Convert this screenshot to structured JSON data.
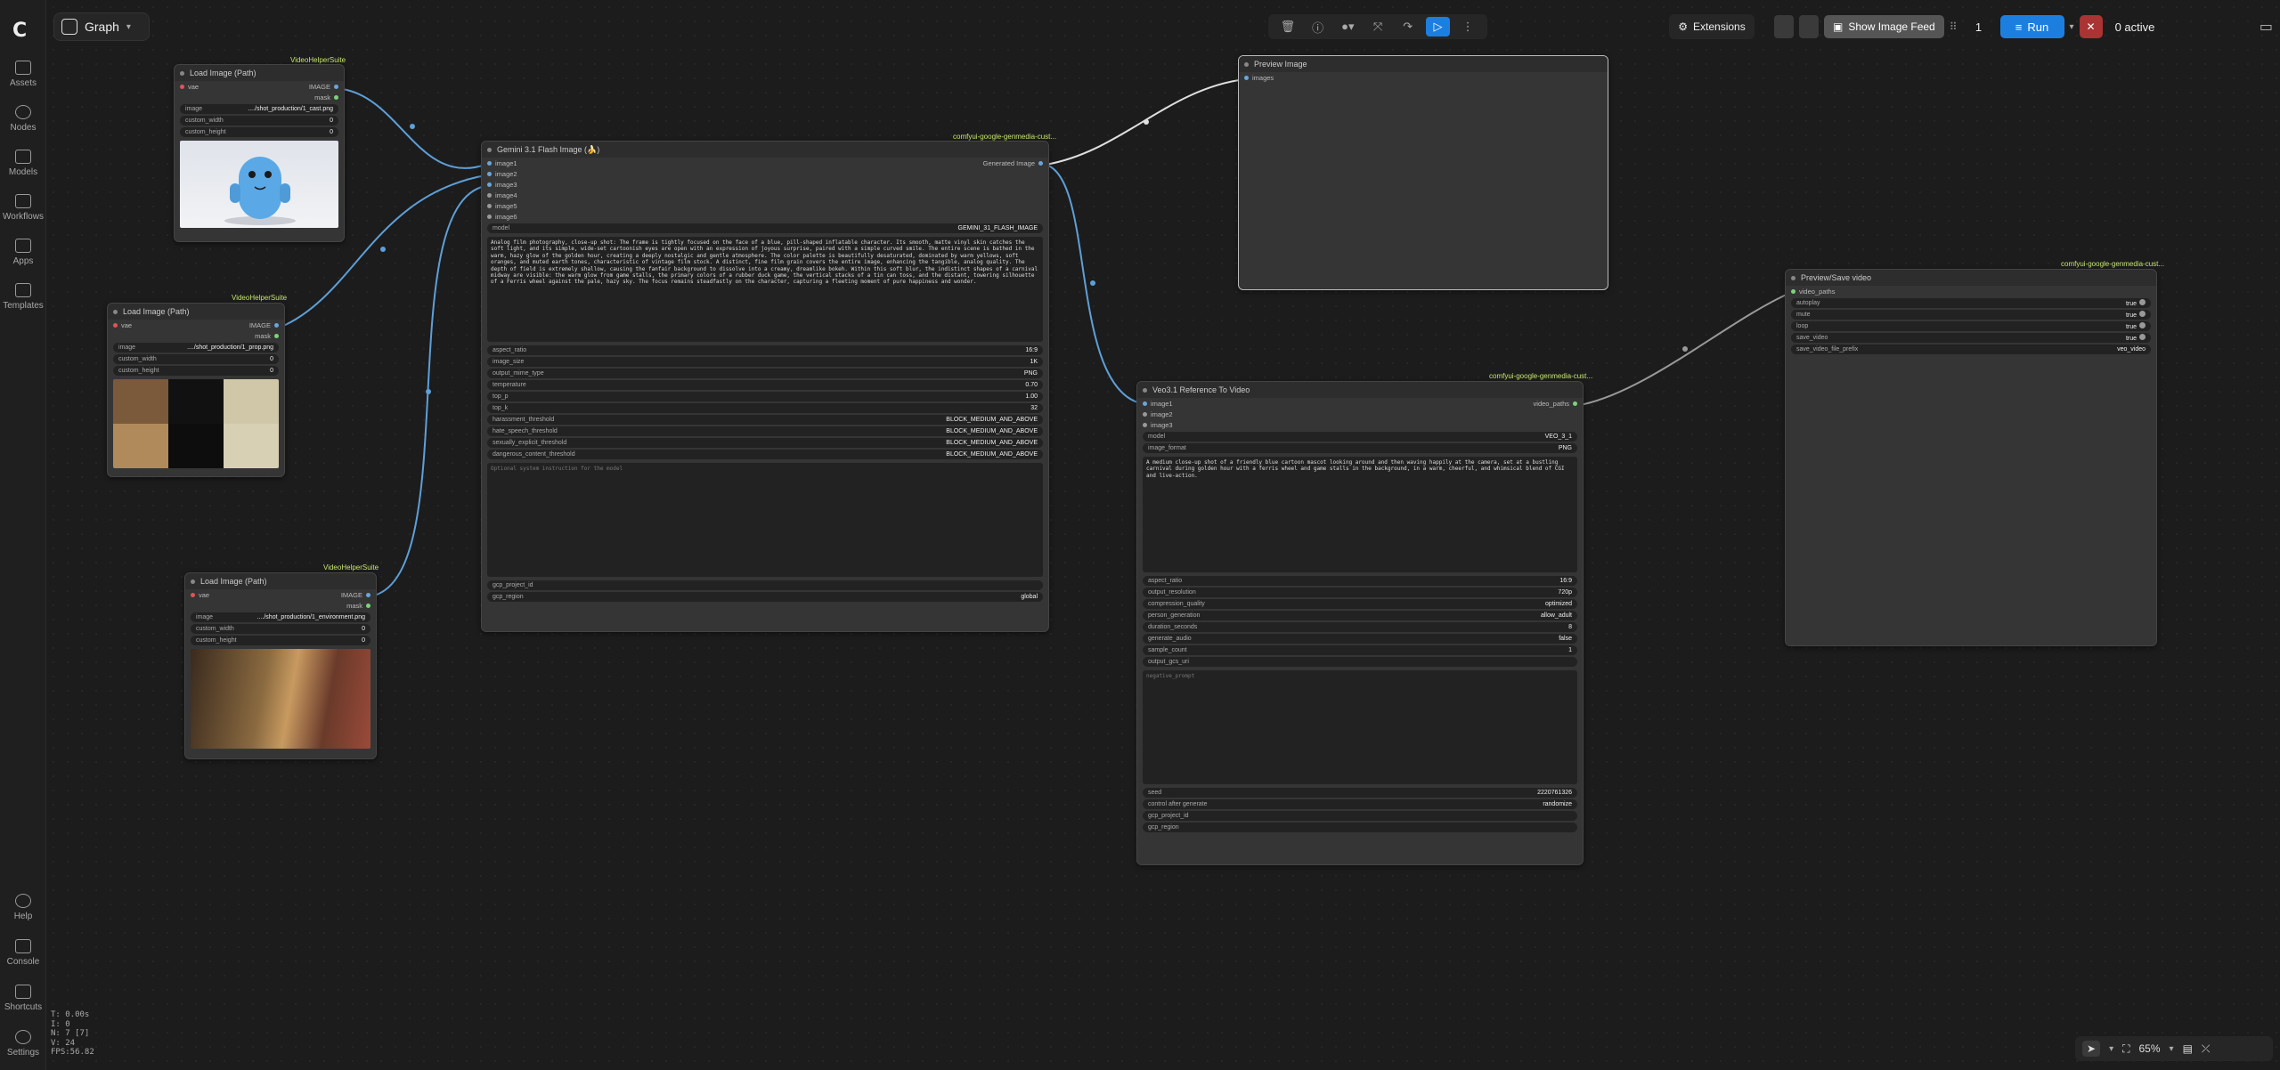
{
  "app": {
    "tab_title": "Graph"
  },
  "sidebar": {
    "items": [
      {
        "label": "Assets"
      },
      {
        "label": "Nodes"
      },
      {
        "label": "Models"
      },
      {
        "label": "Workflows"
      },
      {
        "label": "Apps"
      },
      {
        "label": "Templates"
      }
    ],
    "bottom": [
      {
        "label": "Help"
      },
      {
        "label": "Console"
      },
      {
        "label": "Shortcuts"
      },
      {
        "label": "Settings"
      }
    ]
  },
  "topbar": {
    "extensions_label": "Extensions",
    "show_image_feed_label": "Show Image Feed",
    "queue_count": "1",
    "run_label": "Run",
    "active_label": "0 active"
  },
  "nodes": {
    "load1": {
      "badge": "VideoHelperSuite",
      "title": "Load Image (Path)",
      "out_image": "IMAGE",
      "out_mask": "mask",
      "in_vae": "vae",
      "image_label": "image",
      "image_value": "..../shot_production/1_cast.png",
      "cw_label": "custom_width",
      "cw_value": "0",
      "ch_label": "custom_height",
      "ch_value": "0"
    },
    "load2": {
      "badge": "VideoHelperSuite",
      "title": "Load Image (Path)",
      "out_image": "IMAGE",
      "out_mask": "mask",
      "in_vae": "vae",
      "image_label": "image",
      "image_value": "..../shot_production/1_prop.png",
      "cw_label": "custom_width",
      "cw_value": "0",
      "ch_label": "custom_height",
      "ch_value": "0"
    },
    "load3": {
      "badge": "VideoHelperSuite",
      "title": "Load Image (Path)",
      "out_image": "IMAGE",
      "out_mask": "mask",
      "in_vae": "vae",
      "image_label": "image",
      "image_value": "..../shot_production/1_environment.png",
      "cw_label": "custom_width",
      "cw_value": "0",
      "ch_label": "custom_height",
      "ch_value": "0"
    },
    "gemini": {
      "badge": "comfyui-google-genmedia-cust...",
      "title": "Gemini 3.1 Flash Image (🍌)",
      "inputs": [
        "image1",
        "image2",
        "image3",
        "image4",
        "image5",
        "image6"
      ],
      "output": "Generated Image",
      "model_label": "model",
      "model_value": "GEMINI_31_FLASH_IMAGE",
      "prompt": "Analog film photography, close-up shot: The frame is tightly focused on the face of a blue, pill-shaped inflatable character. Its smooth, matte vinyl skin catches the soft light, and its simple, wide-set cartoonish eyes are open with an expression of joyous surprise, paired with a simple curved smile. The entire scene is bathed in the warm, hazy glow of the golden hour, creating a deeply nostalgic and gentle atmosphere. The color palette is beautifully desaturated, dominated by warm yellows, soft oranges, and muted earth tones, characteristic of vintage film stock. A distinct, fine film grain covers the entire image, enhancing the tangible, analog quality. The depth of field is extremely shallow, causing the fanfair background to dissolve into a creamy, dreamlike bokeh. Within this soft blur, the indistinct shapes of a carnival midway are visible: the warm glow from game stalls, the primary colors of a rubber duck game, the vertical stacks of a tin can toss, and the distant, towering silhouette of a Ferris wheel against the pale, hazy sky. The focus remains steadfastly on the character, capturing a fleeting moment of pure happiness and wonder.",
      "widgets": [
        {
          "label": "aspect_ratio",
          "value": "16:9"
        },
        {
          "label": "image_size",
          "value": "1K"
        },
        {
          "label": "output_mime_type",
          "value": "PNG"
        },
        {
          "label": "temperature",
          "value": "0.70"
        },
        {
          "label": "top_p",
          "value": "1.00"
        },
        {
          "label": "top_k",
          "value": "32"
        },
        {
          "label": "harassment_threshold",
          "value": "BLOCK_MEDIUM_AND_ABOVE"
        },
        {
          "label": "hate_speech_threshold",
          "value": "BLOCK_MEDIUM_AND_ABOVE"
        },
        {
          "label": "sexually_explicit_threshold",
          "value": "BLOCK_MEDIUM_AND_ABOVE"
        },
        {
          "label": "dangerous_content_threshold",
          "value": "BLOCK_MEDIUM_AND_ABOVE"
        }
      ],
      "system_placeholder": "Optional system instruction for the model",
      "gcp_project_label": "gcp_project_id",
      "gcp_region_label": "gcp_region",
      "gcp_region_value": "global"
    },
    "preview": {
      "title": "Preview Image",
      "input": "images"
    },
    "veo": {
      "badge": "comfyui-google-genmedia-cust...",
      "title": "Veo3.1 Reference To Video",
      "inputs": [
        "image1",
        "image2",
        "image3"
      ],
      "output": "video_paths",
      "top_widgets": [
        {
          "label": "model",
          "value": "VEO_3_1"
        },
        {
          "label": "image_format",
          "value": "PNG"
        }
      ],
      "prompt": "A medium close-up shot of a friendly blue cartoon mascot looking around and then waving happily at the camera, set at a bustling carnival during golden hour with a ferris wheel and game stalls in the background, in a warm, cheerful, and whimsical blend of CGI and live-action.",
      "widgets": [
        {
          "label": "aspect_ratio",
          "value": "16:9"
        },
        {
          "label": "output_resolution",
          "value": "720p"
        },
        {
          "label": "compression_quality",
          "value": "optimized"
        },
        {
          "label": "person_generation",
          "value": "allow_adult"
        },
        {
          "label": "duration_seconds",
          "value": "8"
        },
        {
          "label": "generate_audio",
          "value": "false"
        },
        {
          "label": "sample_count",
          "value": "1"
        },
        {
          "label": "output_gcs_uri",
          "value": ""
        }
      ],
      "negative_placeholder": "negative_prompt",
      "bottom_widgets": [
        {
          "label": "seed",
          "value": "2220761326"
        },
        {
          "label": "control after generate",
          "value": "randomize"
        },
        {
          "label": "gcp_project_id",
          "value": ""
        },
        {
          "label": "gcp_region",
          "value": ""
        }
      ]
    },
    "savevideo": {
      "badge": "comfyui-google-genmedia-cust...",
      "title": "Preview/Save video",
      "input": "video_paths",
      "widgets": [
        {
          "label": "autoplay",
          "value": "true"
        },
        {
          "label": "mute",
          "value": "true"
        },
        {
          "label": "loop",
          "value": "true"
        },
        {
          "label": "save_video",
          "value": "true"
        },
        {
          "label": "save_video_file_prefix",
          "value": "veo_video"
        }
      ]
    }
  },
  "stats": {
    "t": "T: 0.00s",
    "i": "I: 0",
    "n": "N: 7 [7]",
    "v": "V: 24",
    "fps": "FPS:56.82"
  },
  "zoom": "65%",
  "colors": {
    "accent": "#1c7fe0",
    "badge": "#c6e76b",
    "wire": "#6aa5dc"
  }
}
